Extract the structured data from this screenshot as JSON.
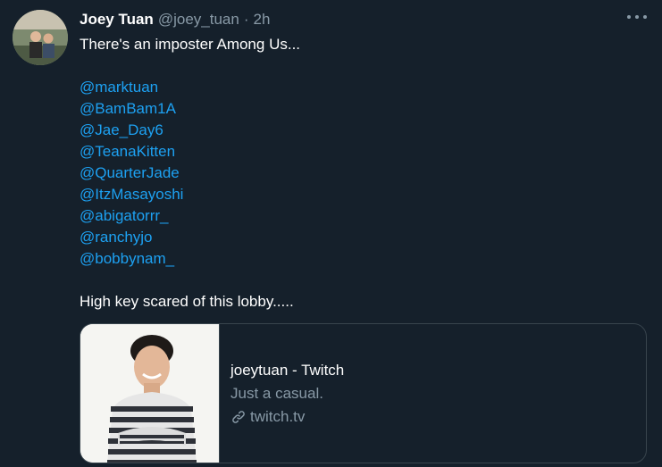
{
  "tweet": {
    "author_name": "Joey Tuan",
    "author_handle": "@joey_tuan",
    "separator": "·",
    "time": "2h",
    "text_intro": "There's an imposter Among Us...",
    "mentions": [
      "@marktuan",
      "@BamBam1A",
      "@Jae_Day6",
      "@TeanaKitten",
      "@QuarterJade",
      "@ItzMasayoshi",
      "@abigatorrr_",
      "@ranchyjo",
      "@bobbynam_"
    ],
    "text_outro": "High key scared of this lobby.....",
    "more_icon": "more-horizontal-icon"
  },
  "card": {
    "title": "joeytuan - Twitch",
    "description": "Just a casual.",
    "domain": "twitch.tv",
    "domain_icon": "link-icon"
  },
  "colors": {
    "background": "#15202b",
    "primary_text": "#ffffff",
    "secondary_text": "#8899a6",
    "link": "#1da1f2",
    "border": "#38444d"
  }
}
